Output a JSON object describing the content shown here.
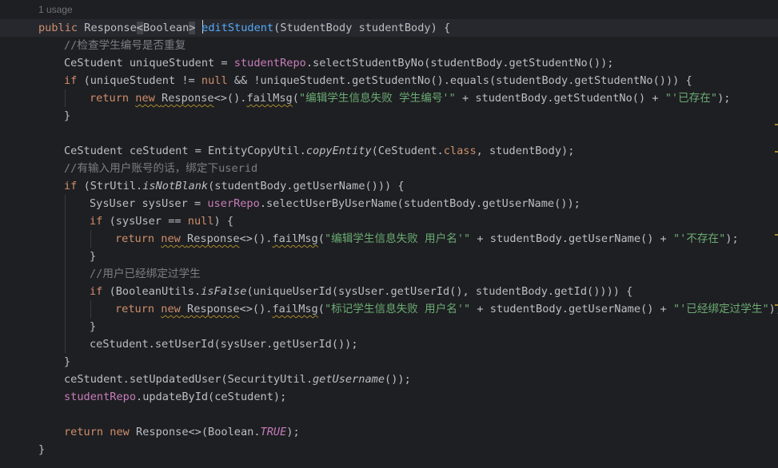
{
  "editor": {
    "usage_hint": "1 usage",
    "lines": [
      {
        "indent": 0,
        "current": true,
        "tokens": [
          {
            "t": "public ",
            "c": "kw"
          },
          {
            "t": "Response",
            "c": "id"
          },
          {
            "t": "<Boolean>",
            "c": "brk"
          },
          {
            "t": " ",
            "c": "id"
          },
          {
            "t": "|",
            "c": "caret"
          },
          {
            "t": "editStudent",
            "c": "fn-sel"
          },
          {
            "t": "(StudentBody studentBody) {",
            "c": "id"
          }
        ]
      },
      {
        "indent": 1,
        "tokens": [
          {
            "t": "//检查学生编号是否重复",
            "c": "cmt"
          }
        ]
      },
      {
        "indent": 1,
        "tokens": [
          {
            "t": "CeStudent uniqueStudent = ",
            "c": "id"
          },
          {
            "t": "studentRepo",
            "c": "fld"
          },
          {
            "t": ".selectStudentByNo(studentBody.getStudentNo());",
            "c": "id"
          }
        ]
      },
      {
        "indent": 1,
        "tokens": [
          {
            "t": "if ",
            "c": "kw"
          },
          {
            "t": "(uniqueStudent != ",
            "c": "id"
          },
          {
            "t": "null ",
            "c": "kw"
          },
          {
            "t": "&& !uniqueStudent.getStudentNo().equals(studentBody.getStudentNo())) {",
            "c": "id"
          }
        ]
      },
      {
        "indent": 2,
        "tokens": [
          {
            "t": "return ",
            "c": "kw"
          },
          {
            "t": "new ",
            "c": "kw-warn"
          },
          {
            "t": "Response",
            "c": "id-warn"
          },
          {
            "t": "<>().",
            "c": "id"
          },
          {
            "t": "failMsg",
            "c": "id-warn"
          },
          {
            "t": "(",
            "c": "id"
          },
          {
            "t": "\"编辑学生信息失败 学生编号'\"",
            "c": "str"
          },
          {
            "t": " + studentBody.getStudentNo() + ",
            "c": "id"
          },
          {
            "t": "\"'已存在\"",
            "c": "str"
          },
          {
            "t": ");",
            "c": "id"
          }
        ]
      },
      {
        "indent": 1,
        "tokens": [
          {
            "t": "}",
            "c": "id"
          }
        ]
      },
      {
        "indent": 0,
        "tokens": []
      },
      {
        "indent": 1,
        "tokens": [
          {
            "t": "CeStudent ceStudent = EntityCopyUtil.",
            "c": "id"
          },
          {
            "t": "copyEntity",
            "c": "st"
          },
          {
            "t": "(CeStudent.",
            "c": "id"
          },
          {
            "t": "class",
            "c": "kw"
          },
          {
            "t": ", studentBody);",
            "c": "id"
          }
        ]
      },
      {
        "indent": 1,
        "tokens": [
          {
            "t": "//有输入用户账号的话，绑定下userid",
            "c": "cmt"
          }
        ]
      },
      {
        "indent": 1,
        "tokens": [
          {
            "t": "if ",
            "c": "kw"
          },
          {
            "t": "(StrUtil.",
            "c": "id"
          },
          {
            "t": "isNotBlank",
            "c": "st"
          },
          {
            "t": "(studentBody.getUserName())) {",
            "c": "id"
          }
        ]
      },
      {
        "indent": 2,
        "tokens": [
          {
            "t": "SysUser sysUser = ",
            "c": "id"
          },
          {
            "t": "userRepo",
            "c": "fld"
          },
          {
            "t": ".selectUserByUserName(studentBody.getUserName());",
            "c": "id"
          }
        ]
      },
      {
        "indent": 2,
        "tokens": [
          {
            "t": "if ",
            "c": "kw"
          },
          {
            "t": "(sysUser == ",
            "c": "id"
          },
          {
            "t": "null",
            "c": "kw"
          },
          {
            "t": ") {",
            "c": "id"
          }
        ]
      },
      {
        "indent": 3,
        "tokens": [
          {
            "t": "return ",
            "c": "kw"
          },
          {
            "t": "new ",
            "c": "kw-warn"
          },
          {
            "t": "Response",
            "c": "id-warn"
          },
          {
            "t": "<>().",
            "c": "id"
          },
          {
            "t": "failMsg",
            "c": "id-warn"
          },
          {
            "t": "(",
            "c": "id"
          },
          {
            "t": "\"编辑学生信息失败 用户名'\"",
            "c": "str"
          },
          {
            "t": " + studentBody.getUserName() + ",
            "c": "id"
          },
          {
            "t": "\"'不存在\"",
            "c": "str"
          },
          {
            "t": ");",
            "c": "id"
          }
        ]
      },
      {
        "indent": 2,
        "tokens": [
          {
            "t": "}",
            "c": "id"
          }
        ]
      },
      {
        "indent": 2,
        "tokens": [
          {
            "t": "//用户已经绑定过学生",
            "c": "cmt"
          }
        ]
      },
      {
        "indent": 2,
        "tokens": [
          {
            "t": "if ",
            "c": "kw"
          },
          {
            "t": "(BooleanUtils.",
            "c": "id"
          },
          {
            "t": "isFalse",
            "c": "st"
          },
          {
            "t": "(uniqueUserId(sysUser.getUserId(), studentBody.getId()))) {",
            "c": "id"
          }
        ]
      },
      {
        "indent": 3,
        "tokens": [
          {
            "t": "return ",
            "c": "kw"
          },
          {
            "t": "new ",
            "c": "kw-warn"
          },
          {
            "t": "Response",
            "c": "id-warn"
          },
          {
            "t": "<>().",
            "c": "id"
          },
          {
            "t": "failMsg",
            "c": "id-warn"
          },
          {
            "t": "(",
            "c": "id"
          },
          {
            "t": "\"标记学生信息失败 用户名'\"",
            "c": "str"
          },
          {
            "t": " + studentBody.getUserName() + ",
            "c": "id"
          },
          {
            "t": "\"'已经绑定过学生\"",
            "c": "str"
          },
          {
            "t": ");",
            "c": "id"
          }
        ]
      },
      {
        "indent": 2,
        "tokens": [
          {
            "t": "}",
            "c": "id"
          }
        ]
      },
      {
        "indent": 2,
        "tokens": [
          {
            "t": "ceStudent.setUserId(sysUser.getUserId());",
            "c": "id"
          }
        ]
      },
      {
        "indent": 1,
        "tokens": [
          {
            "t": "}",
            "c": "id"
          }
        ]
      },
      {
        "indent": 1,
        "tokens": [
          {
            "t": "ceStudent.setUpdatedUser(SecurityUtil.",
            "c": "id"
          },
          {
            "t": "getUsername",
            "c": "st"
          },
          {
            "t": "());",
            "c": "id"
          }
        ]
      },
      {
        "indent": 1,
        "tokens": [
          {
            "t": "studentRepo",
            "c": "fld"
          },
          {
            "t": ".updateById(ceStudent);",
            "c": "id"
          }
        ]
      },
      {
        "indent": 0,
        "tokens": []
      },
      {
        "indent": 1,
        "tokens": [
          {
            "t": "return new ",
            "c": "kw"
          },
          {
            "t": "Response<>(Boolean.",
            "c": "id"
          },
          {
            "t": "TRUE",
            "c": "cst"
          },
          {
            "t": ");",
            "c": "id"
          }
        ]
      },
      {
        "indent": 0,
        "tokens": [
          {
            "t": "}",
            "c": "id"
          }
        ]
      }
    ]
  },
  "colors": {
    "background": "#1e1f22",
    "keyword": "#cf8e6d",
    "function": "#56a8f5",
    "field": "#c77dbb",
    "string": "#6aab73",
    "comment": "#7a7e85",
    "warning": "#a88a2f"
  }
}
